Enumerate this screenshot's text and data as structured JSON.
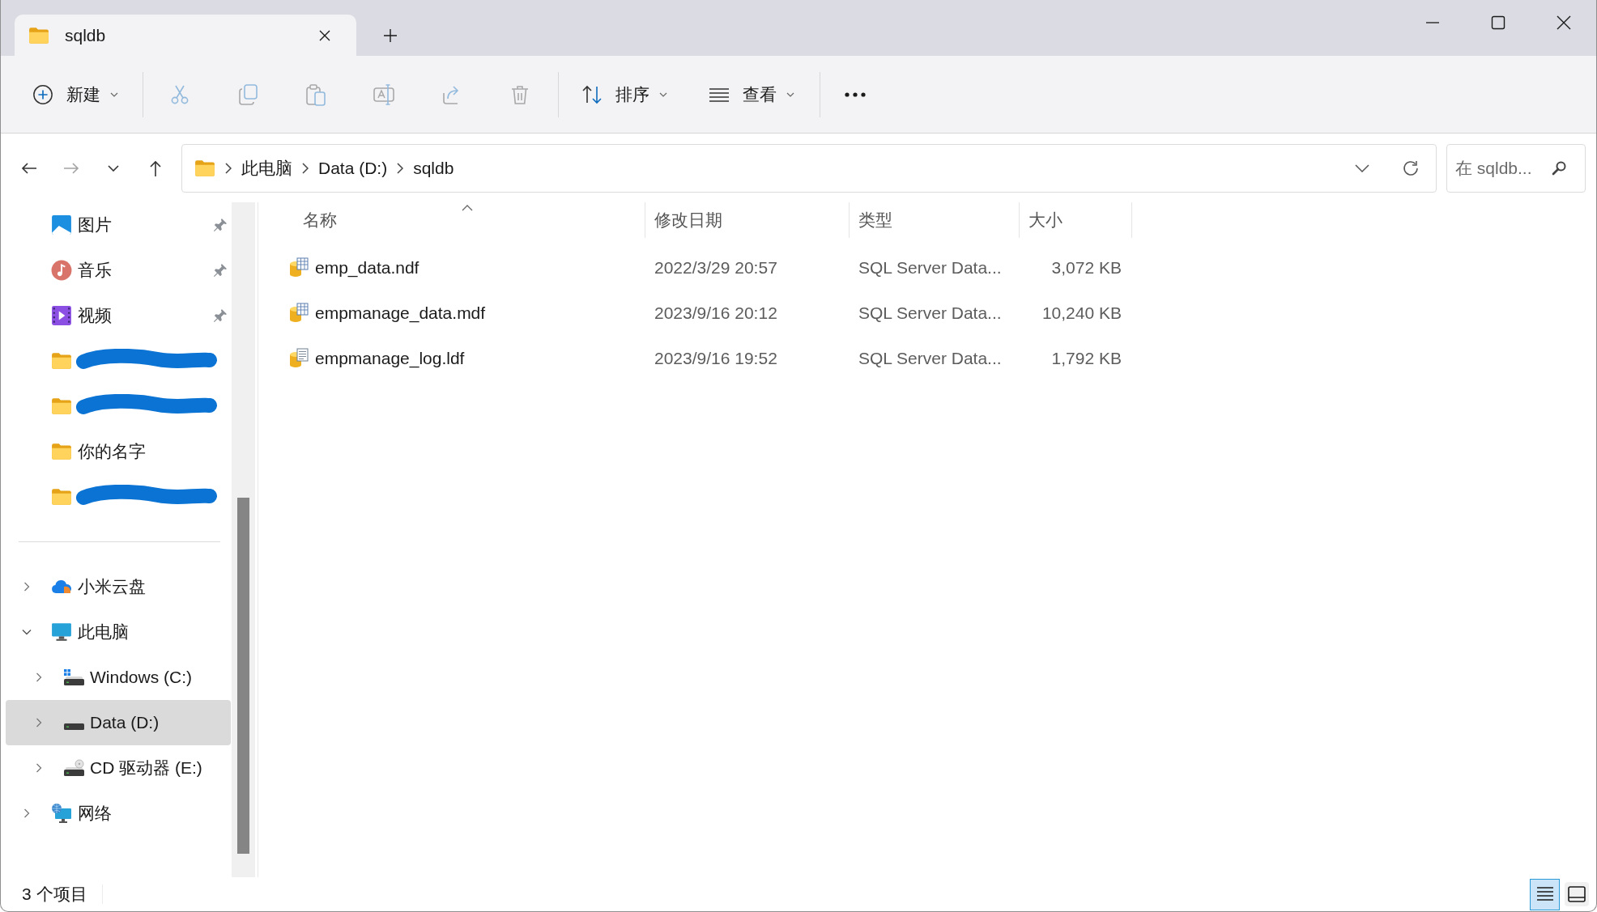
{
  "tabs": [
    {
      "title": "sqldb",
      "selected": true
    }
  ],
  "toolbar": {
    "new_button": {
      "label": "新建"
    },
    "edit_actions": [
      {
        "disabled": true
      },
      {
        "disabled": true
      },
      {
        "disabled": true
      },
      {
        "disabled": true
      },
      {
        "disabled": true
      },
      {
        "disabled": true
      }
    ],
    "sort_button": {
      "label": "排序"
    },
    "view_button": {
      "label": "查看"
    }
  },
  "navigation": {
    "buttons": [
      {
        "disabled": false
      },
      {
        "disabled": true
      },
      {
        "disabled": false
      },
      {
        "disabled": false
      }
    ],
    "breadcrumbs": [
      "此电脑",
      "Data (D:)",
      "sqldb"
    ],
    "search": {
      "placeholder": "在 sqldb..."
    }
  },
  "quick_access": [
    {
      "label": "图片",
      "kind": "pictures",
      "pinned": true,
      "redacted": false
    },
    {
      "label": "音乐",
      "kind": "music",
      "pinned": true,
      "redacted": false
    },
    {
      "label": "视频",
      "kind": "videos",
      "pinned": true,
      "redacted": false
    },
    {
      "kind": "folder",
      "pinned": false,
      "redacted": true
    },
    {
      "kind": "folder",
      "pinned": false,
      "redacted": true
    },
    {
      "label": "你的名字",
      "kind": "folder",
      "pinned": false,
      "redacted": false
    },
    {
      "kind": "folder",
      "pinned": false,
      "redacted": true
    }
  ],
  "navigation_tree": [
    {
      "label": "小米云盘",
      "kind": "cloud",
      "expanded": false,
      "selected": false
    },
    {
      "label": "此电脑",
      "kind": "computer",
      "expanded": true,
      "selected": false,
      "children": [
        {
          "label": "Windows (C:)",
          "kind": "system",
          "expanded": false,
          "selected": false
        },
        {
          "label": "Data (D:)",
          "kind": "drive",
          "expanded": false,
          "selected": true
        },
        {
          "label": "CD 驱动器 (E:)",
          "kind": "optical",
          "expanded": false,
          "selected": false
        }
      ]
    },
    {
      "label": "网络",
      "kind": "network",
      "expanded": false,
      "selected": false
    }
  ],
  "file_list": {
    "columns": [
      {
        "label": "名称",
        "sorted": true
      },
      {
        "label": "修改日期",
        "sorted": false
      },
      {
        "label": "类型",
        "sorted": false
      },
      {
        "label": "大小",
        "sorted": false
      }
    ],
    "rows": [
      {
        "name": "emp_data.ndf",
        "kind": "data",
        "modified": "2022/3/29 20:57",
        "type": "SQL Server Data...",
        "size": "3,072 KB"
      },
      {
        "name": "empmanage_data.mdf",
        "kind": "data",
        "modified": "2023/9/16 20:12",
        "type": "SQL Server Data...",
        "size": "10,240 KB"
      },
      {
        "name": "empmanage_log.ldf",
        "kind": "log",
        "modified": "2023/9/16 19:52",
        "type": "SQL Server Data...",
        "size": "1,792 KB"
      }
    ]
  },
  "status_bar": {
    "item_count": "3 个项目",
    "view_modes": [
      {
        "selected": true
      },
      {
        "selected": false
      }
    ]
  }
}
